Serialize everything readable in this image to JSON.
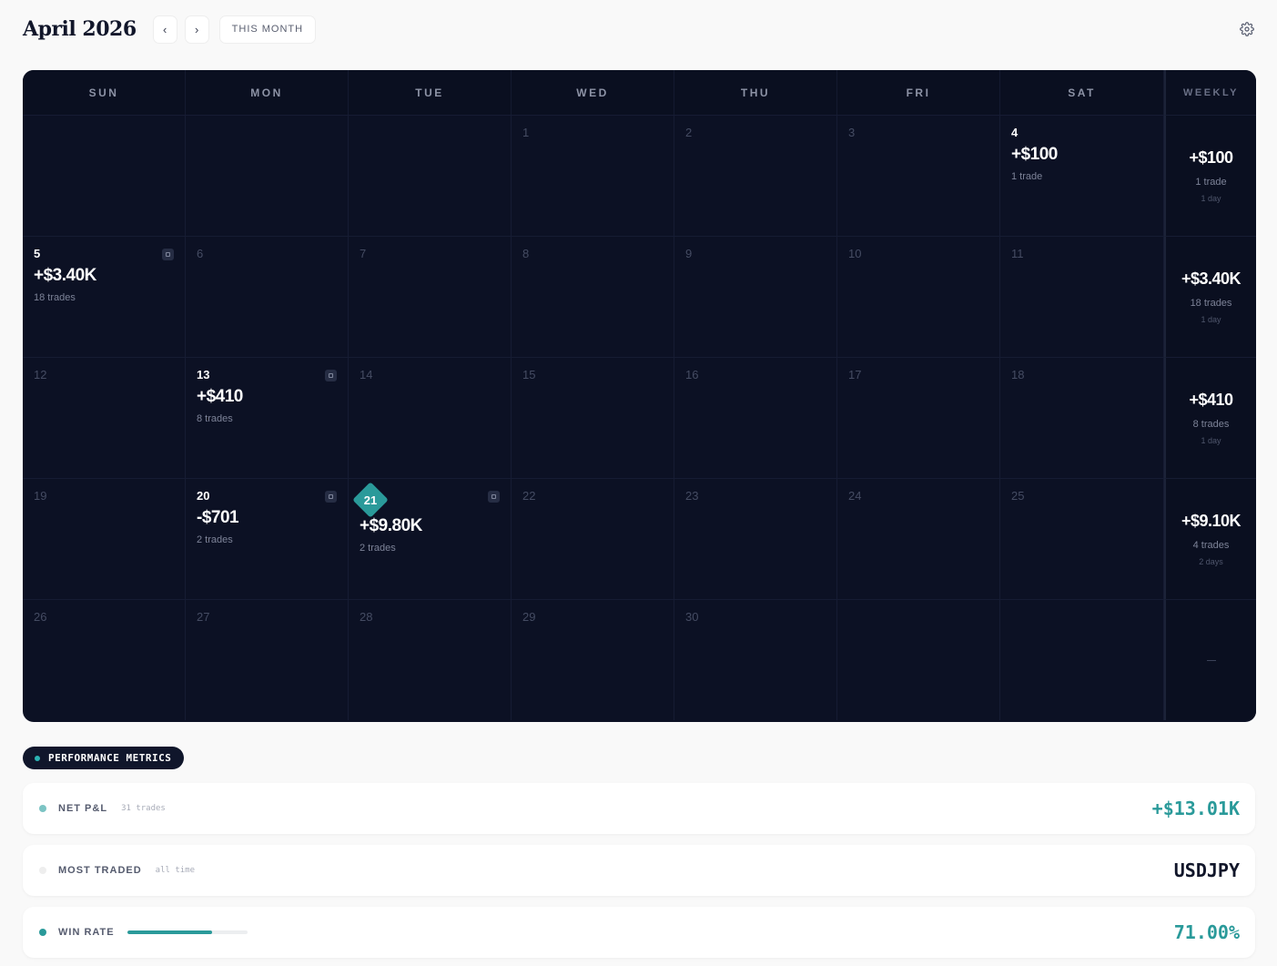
{
  "header": {
    "title": "April 2026",
    "prev_label": "‹",
    "next_label": "›",
    "this_month_label": "THIS MONTH",
    "settings_icon": "gear-icon"
  },
  "calendar": {
    "weekdays": [
      "SUN",
      "MON",
      "TUE",
      "WED",
      "THU",
      "FRI",
      "SAT"
    ],
    "weekly_label": "WEEKLY",
    "weeks": [
      {
        "days": [
          {
            "num": "",
            "empty": true
          },
          {
            "num": "",
            "empty": true
          },
          {
            "num": "",
            "empty": true
          },
          {
            "num": "1"
          },
          {
            "num": "2"
          },
          {
            "num": "3"
          },
          {
            "num": "4",
            "pnl": "+$100",
            "trades": "1 trade",
            "active": true
          }
        ],
        "summary": {
          "pnl": "+$100",
          "trades": "1 trade",
          "days": "1 day"
        }
      },
      {
        "days": [
          {
            "num": "5",
            "pnl": "+$3.40K",
            "trades": "18 trades",
            "active": true,
            "note": true
          },
          {
            "num": "6"
          },
          {
            "num": "7"
          },
          {
            "num": "8"
          },
          {
            "num": "9"
          },
          {
            "num": "10"
          },
          {
            "num": "11"
          }
        ],
        "summary": {
          "pnl": "+$3.40K",
          "trades": "18 trades",
          "days": "1 day"
        }
      },
      {
        "days": [
          {
            "num": "12"
          },
          {
            "num": "13",
            "pnl": "+$410",
            "trades": "8 trades",
            "active": true,
            "note": true
          },
          {
            "num": "14"
          },
          {
            "num": "15"
          },
          {
            "num": "16"
          },
          {
            "num": "17"
          },
          {
            "num": "18"
          }
        ],
        "summary": {
          "pnl": "+$410",
          "trades": "8 trades",
          "days": "1 day"
        }
      },
      {
        "days": [
          {
            "num": "19"
          },
          {
            "num": "20",
            "pnl": "-$701",
            "trades": "2 trades",
            "active": true,
            "note": true
          },
          {
            "num": "21",
            "pnl": "+$9.80K",
            "trades": "2 trades",
            "active": true,
            "note": true,
            "today": true
          },
          {
            "num": "22"
          },
          {
            "num": "23"
          },
          {
            "num": "24"
          },
          {
            "num": "25"
          }
        ],
        "summary": {
          "pnl": "+$9.10K",
          "trades": "4 trades",
          "days": "2 days"
        }
      },
      {
        "days": [
          {
            "num": "26"
          },
          {
            "num": "27"
          },
          {
            "num": "28"
          },
          {
            "num": "29"
          },
          {
            "num": "30"
          },
          {
            "num": "",
            "empty": true
          },
          {
            "num": "",
            "empty": true
          }
        ],
        "summary": null
      }
    ]
  },
  "metrics": {
    "tag_label": "PERFORMANCE METRICS",
    "rows": [
      {
        "label": "NET P&L",
        "sub": "31 trades",
        "value": "+$13.01K",
        "dot_color": "#7cc4c4",
        "value_color": "#2a9a9a"
      },
      {
        "label": "MOST TRADED",
        "sub": "all time",
        "value": "USDJPY",
        "dot_color": "#eeeeee",
        "value_color": "#11162a"
      },
      {
        "label": "WIN RATE",
        "sub": "",
        "value": "71.00%",
        "dot_color": "#2a9a9a",
        "value_color": "#2a9a9a",
        "progress": 0.71
      }
    ]
  }
}
